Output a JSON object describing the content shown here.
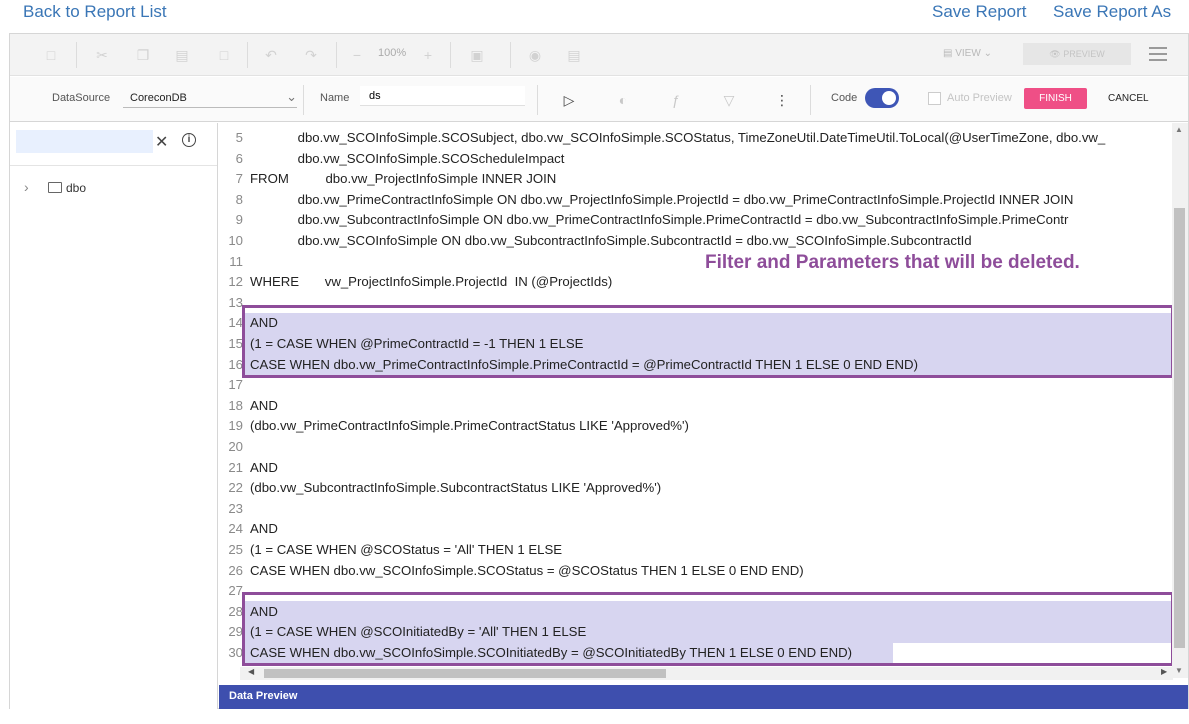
{
  "links": {
    "back": "Back to Report List",
    "save": "Save Report",
    "save_as": "Save Report As"
  },
  "toolbar1": {
    "zoom": "100%",
    "view": "VIEW",
    "preview": "PREVIEW"
  },
  "toolbar2": {
    "datasource_label": "DataSource",
    "datasource_value": "CoreconDB",
    "name_label": "Name",
    "name_value": "ds",
    "code_label": "Code",
    "auto_preview_label": "Auto Preview",
    "finish": "FINISH",
    "cancel": "CANCEL"
  },
  "tree": {
    "root": "dbo"
  },
  "editor": {
    "note": "Filter and Parameters that will be deleted.",
    "lines": [
      {
        "n": "5",
        "code": "             dbo.vw_SCOInfoSimple.SCOSubject, dbo.vw_SCOInfoSimple.SCOStatus, TimeZoneUtil.DateTimeUtil.ToLocal(@UserTimeZone, dbo.vw_"
      },
      {
        "n": "6",
        "code": "             dbo.vw_SCOInfoSimple.SCOScheduleImpact"
      },
      {
        "n": "7",
        "code": "FROM          dbo.vw_ProjectInfoSimple INNER JOIN"
      },
      {
        "n": "8",
        "code": "             dbo.vw_PrimeContractInfoSimple ON dbo.vw_ProjectInfoSimple.ProjectId = dbo.vw_PrimeContractInfoSimple.ProjectId INNER JOIN"
      },
      {
        "n": "9",
        "code": "             dbo.vw_SubcontractInfoSimple ON dbo.vw_PrimeContractInfoSimple.PrimeContractId = dbo.vw_SubcontractInfoSimple.PrimeContr"
      },
      {
        "n": "10",
        "code": "             dbo.vw_SCOInfoSimple ON dbo.vw_SubcontractInfoSimple.SubcontractId = dbo.vw_SCOInfoSimple.SubcontractId"
      },
      {
        "n": "11",
        "code": ""
      },
      {
        "n": "12",
        "code": "WHERE       vw_ProjectInfoSimple.ProjectId  IN (@ProjectIds)"
      },
      {
        "n": "13",
        "code": ""
      },
      {
        "n": "14",
        "code": "AND"
      },
      {
        "n": "15",
        "code": "(1 = CASE WHEN @PrimeContractId = -1 THEN 1 ELSE"
      },
      {
        "n": "16",
        "code": "CASE WHEN dbo.vw_PrimeContractInfoSimple.PrimeContractId = @PrimeContractId THEN 1 ELSE 0 END END)"
      },
      {
        "n": "17",
        "code": ""
      },
      {
        "n": "18",
        "code": "AND"
      },
      {
        "n": "19",
        "code": "(dbo.vw_PrimeContractInfoSimple.PrimeContractStatus LIKE 'Approved%')"
      },
      {
        "n": "20",
        "code": ""
      },
      {
        "n": "21",
        "code": "AND"
      },
      {
        "n": "22",
        "code": "(dbo.vw_SubcontractInfoSimple.SubcontractStatus LIKE 'Approved%')"
      },
      {
        "n": "23",
        "code": ""
      },
      {
        "n": "24",
        "code": "AND"
      },
      {
        "n": "25",
        "code": "(1 = CASE WHEN @SCOStatus = 'All' THEN 1 ELSE"
      },
      {
        "n": "26",
        "code": "CASE WHEN dbo.vw_SCOInfoSimple.SCOStatus = @SCOStatus THEN 1 ELSE 0 END END)"
      },
      {
        "n": "27",
        "code": ""
      },
      {
        "n": "28",
        "code": "AND"
      },
      {
        "n": "29",
        "code": "(1 = CASE WHEN @SCOInitiatedBy = 'All' THEN 1 ELSE"
      },
      {
        "n": "30",
        "code": "CASE WHEN dbo.vw_SCOInfoSimple.SCOInitiatedBy = @SCOInitiatedBy THEN 1 ELSE 0 END END)"
      }
    ]
  },
  "data_preview": "Data Preview",
  "colors": {
    "link": "#3a76b6",
    "finish": "#ef4f86",
    "toggle": "#3e56b6",
    "highlight": "#d7d5f0",
    "annotation": "#8e4d9a",
    "preview_bar": "#3e4fae"
  }
}
